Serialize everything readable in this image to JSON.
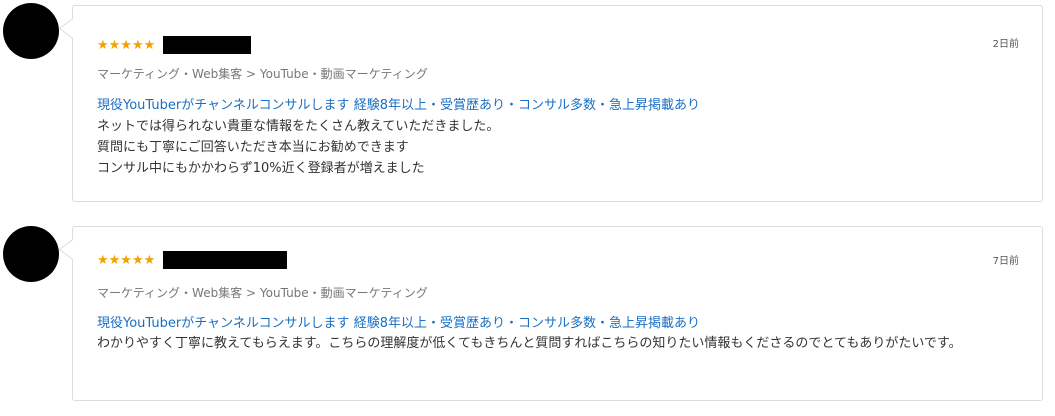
{
  "reviews": [
    {
      "stars": "★★★★★",
      "date": "2日前",
      "category": "マーケティング・Web集客 > YouTube・動画マーケティング",
      "service_title": "現役YouTuberがチャンネルコンサルします 経験8年以上・受賞歴あり・コンサル多数・急上昇掲載あり",
      "lines": [
        "ネットでは得られない貴重な情報をたくさん教えていただきました。",
        "質問にも丁寧にご回答いただき本当にお勧めできます",
        "コンサル中にもかかわらず10%近く登録者が増えました"
      ]
    },
    {
      "stars": "★★★★★",
      "date": "7日前",
      "category": "マーケティング・Web集客 > YouTube・動画マーケティング",
      "service_title": "現役YouTuberがチャンネルコンサルします 経験8年以上・受賞歴あり・コンサル多数・急上昇掲載あり",
      "lines": [
        "わかりやすく丁寧に教えてもらえます。こちらの理解度が低くてもきちんと質問すればこちらの知りたい情報もくださるのでとてもありがたいです。"
      ]
    }
  ],
  "colors": {
    "star": "#f4a100",
    "link": "#1a6fc4",
    "border": "#dcdcdc",
    "category": "#777777"
  }
}
